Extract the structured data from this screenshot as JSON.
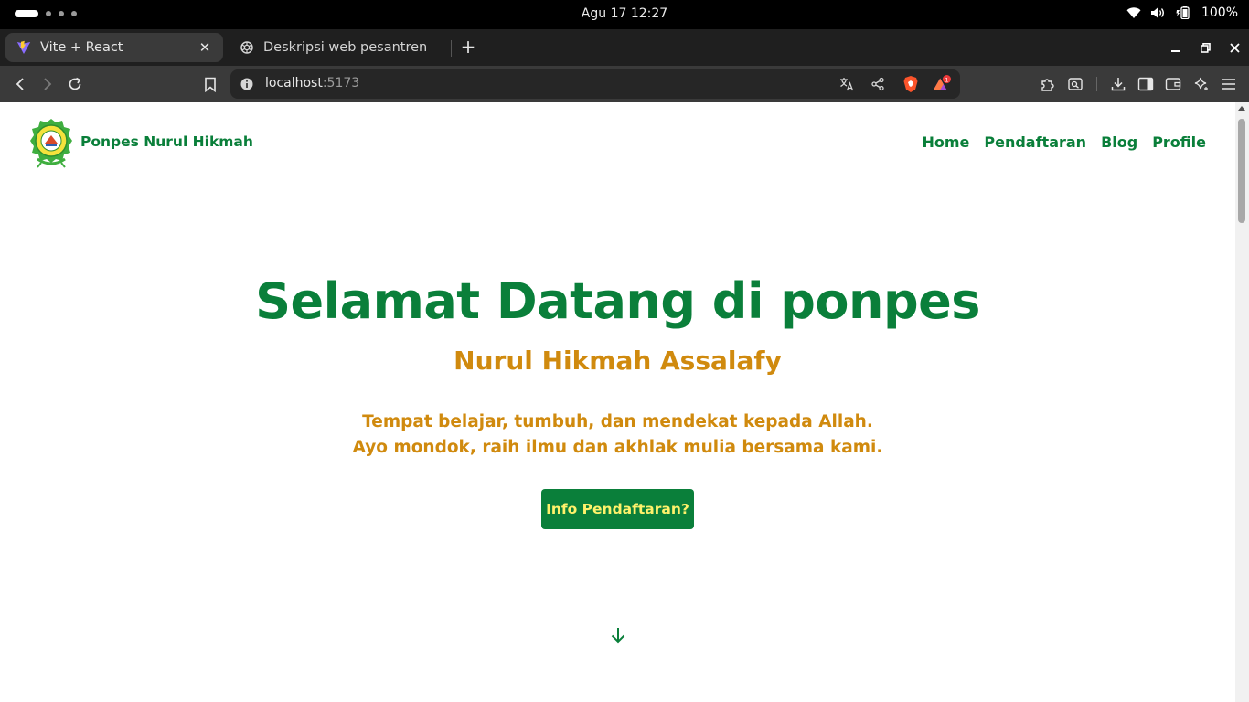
{
  "os": {
    "clock": "Agu 17  12:27",
    "battery": "100%"
  },
  "tabs": [
    {
      "title": "Vite + React",
      "favicon": "vite-logo-icon",
      "active": true
    },
    {
      "title": "Deskripsi web pesantren",
      "favicon": "openai-logo-icon",
      "active": false
    }
  ],
  "toolbar": {
    "url_host": "localhost",
    "url_port": ":5173",
    "alert_badge": "1"
  },
  "site": {
    "brand": "Ponpes Nurul Hikmah",
    "nav": [
      "Home",
      "Pendaftaran",
      "Blog",
      "Profile"
    ],
    "hero_title": "Selamat Datang di ponpes",
    "hero_subtitle": "Nurul Hikmah Assalafy",
    "hero_line1": "Tempat belajar, tumbuh, dan mendekat kepada Allah.",
    "hero_line2": "Ayo mondok, raih ilmu dan akhlak mulia bersama kami.",
    "cta_label": "Info Pendaftaran?"
  },
  "colors": {
    "primary_green": "#0a7f3a",
    "accent_gold": "#d08a0e",
    "cta_text": "#fff26b"
  }
}
